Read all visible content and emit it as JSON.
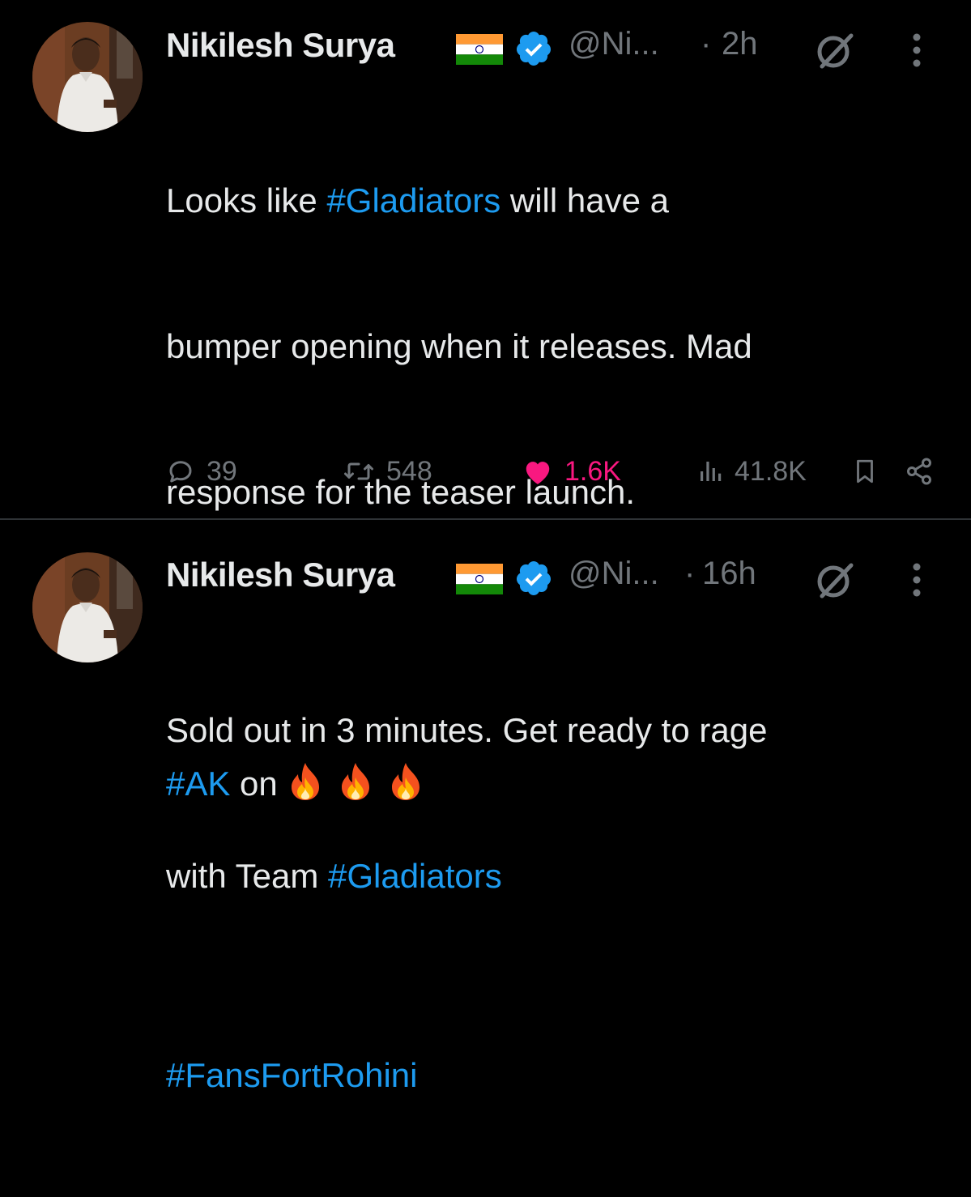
{
  "tweets": [
    {
      "author_name": "Nikilesh Surya",
      "handle": "@Ni...",
      "separator": "·",
      "time": "2h",
      "body": {
        "line1_a": "Looks like ",
        "line1_tag": "#Gladiators",
        "line1_b": " will have a",
        "line2": "bumper opening when it releases. Mad",
        "line3": "response for the teaser launch.",
        "line5_tag": "#AK",
        "line5_b": " on ",
        "line7_tag": "#FansFortRohini"
      },
      "stats": {
        "replies": "39",
        "reposts": "548",
        "likes": "1.6K",
        "views": "41.8K"
      },
      "liked": true
    },
    {
      "author_name": "Nikilesh Surya",
      "handle": "@Ni...",
      "separator": "·",
      "time": "16h",
      "body": {
        "line1": "Sold out in 3 minutes. Get ready to rage",
        "line2_a": "with Team ",
        "line2_tag": "#Gladiators"
      }
    }
  ],
  "colors": {
    "background": "#000000",
    "text": "#e7e9ea",
    "secondary": "#71767b",
    "link": "#1d9bf0",
    "like": "#f91880",
    "divider": "#2f3336"
  },
  "icons": [
    "avatar",
    "india-flag-icon",
    "verified-badge-icon",
    "grok-icon",
    "more-icon",
    "fire-emoji-icon",
    "reply-icon",
    "repost-icon",
    "like-icon",
    "views-icon",
    "bookmark-icon",
    "share-icon"
  ]
}
